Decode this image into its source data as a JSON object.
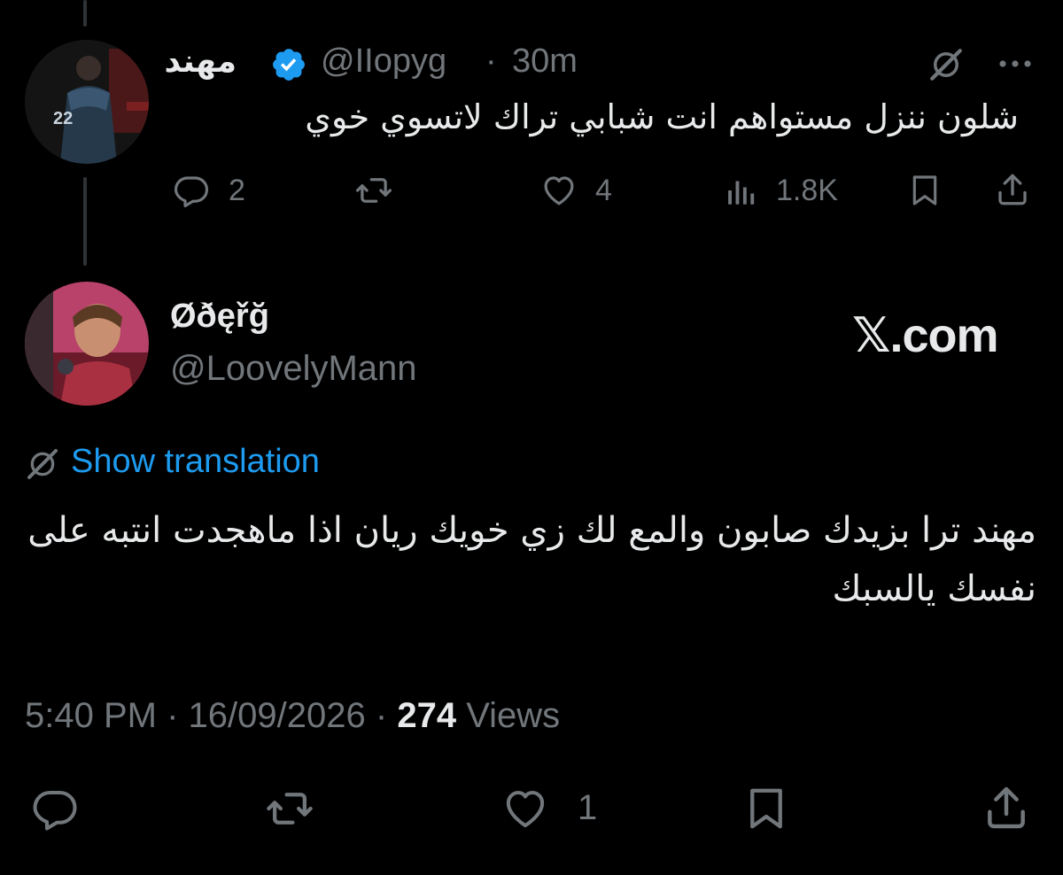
{
  "parent_tweet": {
    "author_name": "مهند",
    "verified": true,
    "handle": "@IIopyg",
    "separator": "·",
    "time": "30m",
    "text": "شلون ننزل مستواهم انت شبابي تراك لاتسوي خوي",
    "actions": {
      "reply_count": "2",
      "like_count": "4",
      "views_count": "1.8K"
    }
  },
  "reply_tweet": {
    "author_name": "Øðęřğ",
    "handle": "@LoovelyMann",
    "watermark": "𝕏.com",
    "show_translation": "Show translation",
    "text": "مهند ترا بزيدك صابون والمع لك زي خويك ريان اذا ماهجدت انتبه على نفسك يالسبك",
    "meta": {
      "time": "5:40 PM",
      "date": "16/09/2026",
      "separator": "·",
      "views_count": "274",
      "views_label": "Views"
    },
    "actions": {
      "like_count": "1"
    }
  },
  "colors": {
    "background": "#000000",
    "text_primary": "#e7e9ea",
    "text_secondary": "#71767b",
    "link": "#1d9bf0",
    "verified_badge": "#1d9bf0",
    "thread_line": "#2f3336"
  },
  "icons": [
    "grok-icon",
    "more-icon",
    "verified-badge-icon",
    "reply-icon",
    "retweet-icon",
    "like-icon",
    "views-icon",
    "bookmark-icon",
    "share-icon",
    "translate-icon"
  ]
}
